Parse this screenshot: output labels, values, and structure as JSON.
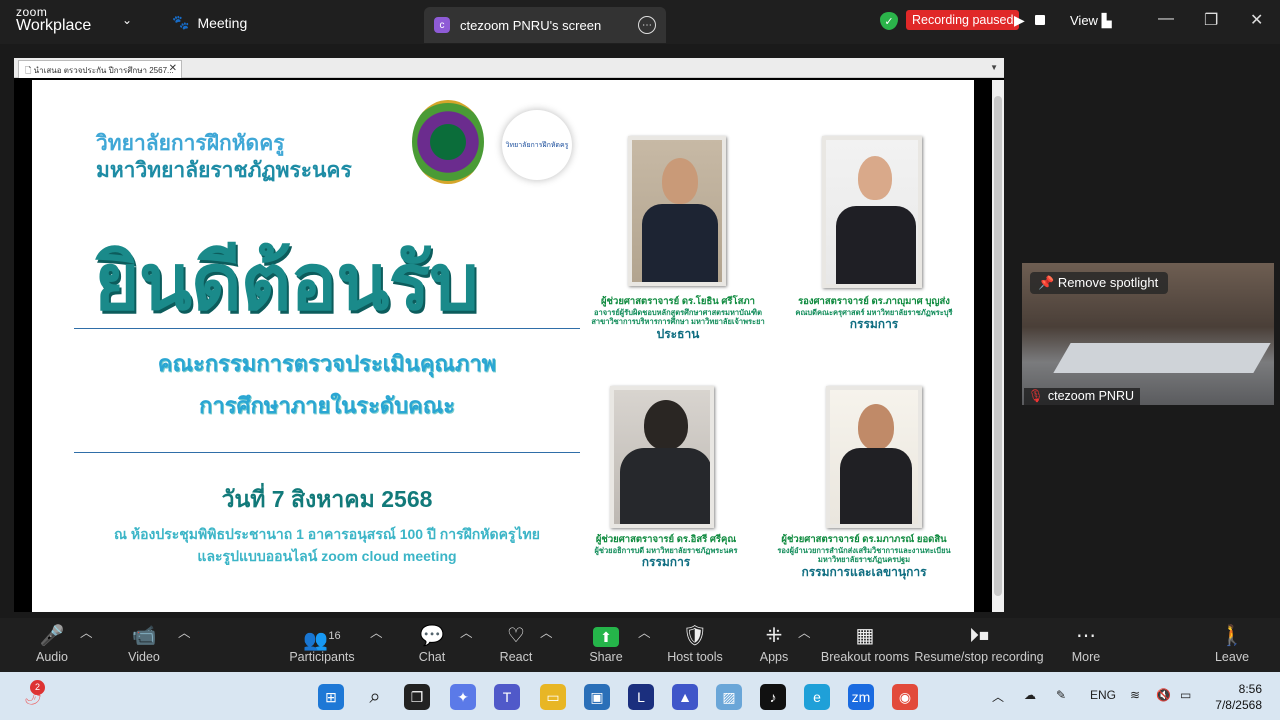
{
  "topbar": {
    "brand_line1": "zoom",
    "brand_line2": "Workplace",
    "meeting_label": "Meeting",
    "share_tab_title": "ctezoom PNRU's screen",
    "share_tab_initial": "c",
    "recording_status": "Recording paused",
    "view_label": "View"
  },
  "browser": {
    "tab_title": "นำเสนอ ตรวจประกัน ปีการศึกษา 2567..."
  },
  "slide": {
    "college_line1": "วิทยาลัยการฝึกหัดครู",
    "college_line2": "มหาวิทยาลัยราชภัฏพระนคร",
    "logo2_text": "วิทยาลัยการฝึกหัดครู",
    "welcome": "ยินดีต้อนรับ",
    "committee_line1": "คณะกรรมการตรวจประเมินคุณภาพ",
    "committee_line2": "การศึกษาภายในระดับคณะ",
    "date": "วันที่ 7 สิงหาคม 2568",
    "venue_line1": "ณ ห้องประชุมพิพิธประชานาถ 1 อาคารอนุสรณ์ 100 ปี การฝึกหัดครูไทย",
    "venue_line2": "และรูปแบบออนไลน์ zoom cloud meeting",
    "people": [
      {
        "name": "ผู้ช่วยศาสตราจารย์ ดร.โยธิน ศรีโสภา",
        "sub1": "อาจารย์ผู้รับผิดชอบหลักสูตรศึกษาศาสตรมหาบัณฑิต",
        "sub2": "สาขาวิชาการบริหารการศึกษา มหาวิทยาลัยเจ้าพระยา",
        "role": "ประธาน"
      },
      {
        "name": "รองศาสตราจารย์ ดร.ภาญุมาศ บุญส่ง",
        "sub1": "คณบดีคณะครุศาสตร์ มหาวิทยาลัยราชภัฏพระบุรี",
        "sub2": "",
        "role": "กรรมการ"
      },
      {
        "name": "ผู้ช่วยศาสตราจารย์ ดร.อิสรี ศรีคุณ",
        "sub1": "ผู้ช่วยอธิการบดี มหาวิทยาลัยราชภัฏพระนคร",
        "sub2": "",
        "role": "กรรมการ"
      },
      {
        "name": "ผู้ช่วยศาสตราจารย์ ดร.มภาภรณ์ ยอดสิน",
        "sub1": "รองผู้อำนวยการสำนักส่งเสริมวิชาการและงานทะเบียน",
        "sub2": "มหาวิทยาลัยราชภัฏนครปฐม",
        "role": "กรรมการและเลขานุการ"
      }
    ]
  },
  "video": {
    "remove_spotlight": "Remove spotlight",
    "participant_name": "ctezoom PNRU"
  },
  "toolbar": {
    "audio": "Audio",
    "video": "Video",
    "participants": "Participants",
    "participants_count": "16",
    "chat": "Chat",
    "react": "React",
    "share": "Share",
    "host_tools": "Host tools",
    "apps": "Apps",
    "breakout": "Breakout rooms",
    "resume_stop": "Resume/stop recording",
    "more": "More",
    "leave": "Leave"
  },
  "taskbar": {
    "notification_count": "2",
    "lang": "ENG",
    "time": "8:56",
    "date": "7/8/2568"
  },
  "colors": {
    "zoom_bg": "#1f1f1f",
    "recording_red": "#e02828",
    "share_green": "#25b54a",
    "slide_teal": "#1a8a8a",
    "slide_blue": "#3fa7d6"
  }
}
